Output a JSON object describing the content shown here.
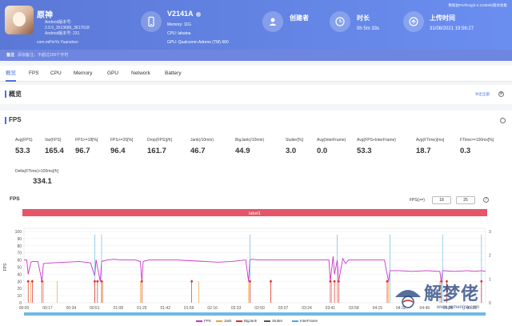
{
  "header": {
    "game_name": "原神",
    "game_info": [
      "Android版本号:",
      "2.0.0_3513686_3617618",
      "Android版本号: 231"
    ],
    "package": "com.miHoYo.Yuanshen",
    "device_name": "V2141A",
    "device_memory": "Memory: 11G",
    "device_cpu": "CPU: lahaina",
    "device_gpu": "GPU: Qualcomm Adreno (TM) 660",
    "creator_label": "创建者",
    "duration_label": "时长",
    "duration_value": "0h 5m 33s",
    "upload_label": "上传时间",
    "upload_value": "31/08/2021 19:56:27",
    "version_text": "数据由PerfDog(6.0.210836)版本收集",
    "colors": {
      "header_start": "#5b78d6",
      "header_end": "#6a8ef0"
    }
  },
  "note": {
    "label": "备注",
    "placeholder": "添加备注，不超过200个字符"
  },
  "tabs": [
    "概览",
    "FPS",
    "CPU",
    "Memory",
    "GPU",
    "Network",
    "Battery"
  ],
  "overview": {
    "title": "概览",
    "export": "导出全部"
  },
  "fps_section": {
    "title": "FPS",
    "metrics": [
      {
        "label": "Avg(FPS)",
        "value": "53.3"
      },
      {
        "label": "Var(FPS)",
        "value": "165.4"
      },
      {
        "label": "FPS>=18[%]",
        "value": "96.7"
      },
      {
        "label": "FPS>=25[%]",
        "value": "96.4"
      },
      {
        "label": "Drop(FPS)[/h]",
        "value": "161.7"
      },
      {
        "label": "Jank(/10min)",
        "value": "46.7"
      },
      {
        "label": "BigJank(/10min)",
        "value": "44.9"
      },
      {
        "label": "Stutter[%]",
        "value": "3.0"
      },
      {
        "label": "Avg(InterFrame)",
        "value": "0.0"
      },
      {
        "label": "Avg(FPS+InterFrame)",
        "value": "53.3"
      },
      {
        "label": "Avg(FTime)[ms]",
        "value": "18.7"
      },
      {
        "label": "FTime>=100ms[%]",
        "value": "0.3"
      },
      {
        "label": "Delta(FTime)>100ms[/h]",
        "value": "334.1"
      }
    ]
  },
  "chart": {
    "title": "FPS",
    "fps_filter_label": "FPS(>=)",
    "fps_filter_values": [
      "18",
      "25"
    ],
    "label_bar": "label1",
    "colors": {
      "fps": "#cc33cc",
      "jank": "#f0a030",
      "bigjank": "#e03030",
      "stutter": "#555555",
      "interframe": "#4aa8e0",
      "label": "#e5556a"
    }
  },
  "chart_data": {
    "type": "line",
    "ylabel": "FPS",
    "ylim": [
      0,
      100
    ],
    "y_ticks": [
      "100",
      "90",
      "80",
      "70",
      "60",
      "50",
      "40",
      "30",
      "20",
      "10",
      "0"
    ],
    "y2_ticks": [
      "3",
      "2",
      "1",
      "0"
    ],
    "x_ticks": [
      "00:00",
      "00:17",
      "00:34",
      "00:51",
      "01:08",
      "01:25",
      "01:42",
      "01:59",
      "02:16",
      "02:33",
      "02:50",
      "03:07",
      "03:24",
      "03:41",
      "03:58",
      "04:15",
      "04:32",
      "04:49",
      "05:06",
      "05:23"
    ],
    "series": [
      {
        "name": "FPS",
        "x": [
          0,
          2,
          3,
          5,
          6,
          10,
          13,
          14,
          20,
          30,
          40,
          48,
          51,
          52,
          55,
          56,
          60,
          65,
          70,
          80,
          84,
          85,
          86,
          90,
          100,
          110,
          120,
          130,
          140,
          150,
          160,
          162,
          163,
          164,
          170,
          180,
          200,
          210,
          220,
          221,
          223,
          224,
          226,
          227,
          230,
          232,
          234,
          240,
          250,
          260,
          263,
          264,
          270,
          280,
          290,
          300,
          301,
          302,
          310,
          320,
          325,
          330,
          333
        ],
        "y": [
          60,
          60,
          40,
          57,
          58,
          58,
          30,
          55,
          56,
          57,
          58,
          56,
          38,
          60,
          30,
          58,
          60,
          61,
          60,
          60,
          58,
          30,
          58,
          60,
          60,
          60,
          59,
          58,
          57,
          58,
          60,
          30,
          60,
          61,
          60,
          60,
          60,
          60,
          60,
          30,
          65,
          40,
          60,
          30,
          62,
          55,
          60,
          60,
          60,
          60,
          30,
          45,
          45,
          44,
          45,
          44,
          30,
          45,
          44,
          45,
          44,
          45,
          44
        ]
      },
      {
        "name": "Jank",
        "x": [
          5,
          14,
          24,
          51,
          57,
          84,
          126,
          162,
          178,
          222,
          226,
          263,
          300
        ],
        "y": [
          1,
          1,
          1,
          1,
          1,
          1,
          1,
          1,
          1,
          1,
          1,
          1,
          1
        ]
      },
      {
        "name": "BigJank",
        "x": [
          3,
          6,
          13,
          51,
          53,
          56,
          85,
          121,
          163,
          178,
          221,
          224,
          227,
          262,
          301,
          305,
          330
        ],
        "y": [
          1,
          1,
          1,
          1,
          1,
          1,
          1,
          1,
          1,
          1,
          1,
          1,
          1,
          1,
          1,
          1,
          1
        ]
      },
      {
        "name": "Stutter",
        "x": [],
        "y": []
      },
      {
        "name": "InterFrame",
        "x": [],
        "y": []
      }
    ]
  },
  "legend": [
    "FPS",
    "Jank",
    "BigJank",
    "Stutter",
    "InterFrame"
  ],
  "watermark": {
    "text": "解梦佬",
    "url": "www.jiemengla.com"
  }
}
